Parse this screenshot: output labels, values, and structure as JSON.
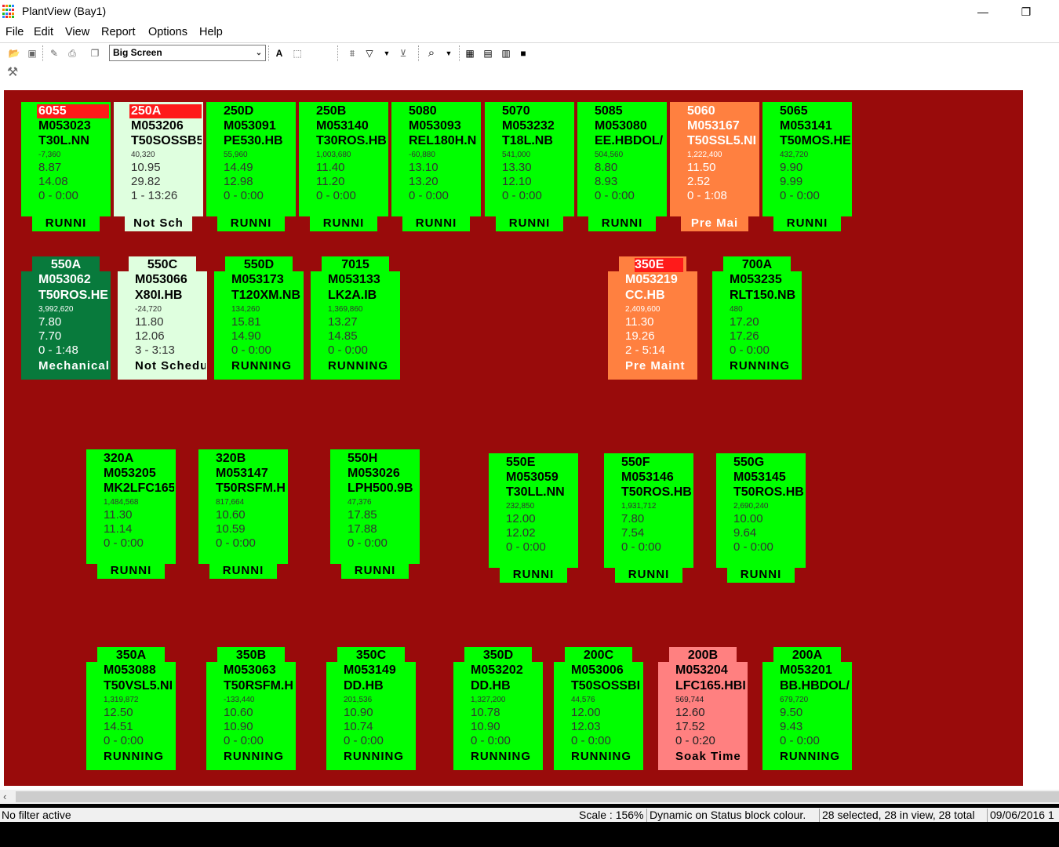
{
  "window": {
    "title": "PlantView (Bay1)",
    "minimize": "—",
    "restore": "❐"
  },
  "menu": [
    "File",
    "Edit",
    "View",
    "Report",
    "Options",
    "Help"
  ],
  "toolbar": {
    "view_select": "Big Screen"
  },
  "colors": {
    "running": "#00ff00",
    "not_scheduled": "#dfffdf",
    "pre_maint": "#ff8040",
    "mechanical": "#087a3c",
    "soak": "#ff8080",
    "canvas": "#990b0b",
    "alarm": "#ff1a1a"
  },
  "machines": [
    {
      "id": "6055",
      "order": "M053023",
      "part": "T30L.NN",
      "count": "-7,360",
      "v1": "8.87",
      "v2": "14.08",
      "time": "0 - 0:00",
      "status": "RUNNI",
      "state": "running",
      "alarm": true
    },
    {
      "id": "250A",
      "order": "M053206",
      "part": "T50SOSSB5",
      "count": "40,320",
      "v1": "10.95",
      "v2": "29.82",
      "time": "1 - 13:26",
      "status": "Not Sch",
      "state": "not_scheduled",
      "alarm": true
    },
    {
      "id": "250D",
      "order": "M053091",
      "part": "PE530.HB",
      "count": "55,960",
      "v1": "14.49",
      "v2": "12.98",
      "time": "0 - 0:00",
      "status": "RUNNI",
      "state": "running"
    },
    {
      "id": "250B",
      "order": "M053140",
      "part": "T30ROS.HB",
      "count": "1,003,680",
      "v1": "11.40",
      "v2": "11.20",
      "time": "0 - 0:00",
      "status": "RUNNI",
      "state": "running"
    },
    {
      "id": "5080",
      "order": "M053093",
      "part": "REL180H.N",
      "count": "-60,880",
      "v1": "13.10",
      "v2": "13.20",
      "time": "0 - 0:00",
      "status": "RUNNI",
      "state": "running"
    },
    {
      "id": "5070",
      "order": "M053232",
      "part": "T18L.NB",
      "count": "541,000",
      "v1": "13.30",
      "v2": "12.10",
      "time": "0 - 0:00",
      "status": "RUNNI",
      "state": "running"
    },
    {
      "id": "5085",
      "order": "M053080",
      "part": "EE.HBDOL/",
      "count": "504,560",
      "v1": "8.80",
      "v2": "8.93",
      "time": "0 - 0:00",
      "status": "RUNNI",
      "state": "running"
    },
    {
      "id": "5060",
      "order": "M053167",
      "part": "T50SSL5.NI",
      "count": "1,222,400",
      "v1": "11.50",
      "v2": "2.52",
      "time": "0 - 1:08",
      "status": "Pre Mai",
      "state": "pre_maint"
    },
    {
      "id": "5065",
      "order": "M053141",
      "part": "T50MOS.HE",
      "count": "432,720",
      "v1": "9.90",
      "v2": "9.99",
      "time": "0 - 0:00",
      "status": "RUNNI",
      "state": "running"
    },
    {
      "id": "550A",
      "order": "M053062",
      "part": "T50ROS.HE",
      "count": "3,992,620",
      "v1": "7.80",
      "v2": "7.70",
      "time": "0 - 1:48",
      "status": "Mechanical",
      "state": "mechanical"
    },
    {
      "id": "550C",
      "order": "M053066",
      "part": "X80I.HB",
      "count": "-24,720",
      "v1": "11.80",
      "v2": "12.06",
      "time": "3 - 3:13",
      "status": "Not Schedu",
      "state": "not_scheduled"
    },
    {
      "id": "550D",
      "order": "M053173",
      "part": "T120XM.NB",
      "count": "134,260",
      "v1": "15.81",
      "v2": "14.90",
      "time": "0 - 0:00",
      "status": "RUNNING",
      "state": "running"
    },
    {
      "id": "7015",
      "order": "M053133",
      "part": "LK2A.IB",
      "count": "1,369,860",
      "v1": "13.27",
      "v2": "14.85",
      "time": "0 - 0:00",
      "status": "RUNNING",
      "state": "running"
    },
    {
      "id": "350E",
      "order": "M053219",
      "part": "CC.HB",
      "count": "2,409,600",
      "v1": "11.30",
      "v2": "19.26",
      "time": "2 - 5:14",
      "status": "Pre Maint",
      "state": "pre_maint",
      "alarm": true
    },
    {
      "id": "700A",
      "order": "M053235",
      "part": "RLT150.NB",
      "count": "480",
      "v1": "17.20",
      "v2": "17.26",
      "time": "0 - 0:00",
      "status": "RUNNING",
      "state": "running"
    },
    {
      "id": "320A",
      "order": "M053205",
      "part": "MK2LFC165",
      "count": "1,484,568",
      "v1": "11.30",
      "v2": "11.14",
      "time": "0 - 0:00",
      "status": "RUNNI",
      "state": "running"
    },
    {
      "id": "320B",
      "order": "M053147",
      "part": "T50RSFM.H",
      "count": "817,664",
      "v1": "10.60",
      "v2": "10.59",
      "time": "0 - 0:00",
      "status": "RUNNI",
      "state": "running"
    },
    {
      "id": "550H",
      "order": "M053026",
      "part": "LPH500.9B",
      "count": "47,376",
      "v1": "17.85",
      "v2": "17.88",
      "time": "0 - 0:00",
      "status": "RUNNI",
      "state": "running"
    },
    {
      "id": "550E",
      "order": "M053059",
      "part": "T30LL.NN",
      "count": "232,850",
      "v1": "12.00",
      "v2": "12.02",
      "time": "0 - 0:00",
      "status": "RUNNI",
      "state": "running"
    },
    {
      "id": "550F",
      "order": "M053146",
      "part": "T50ROS.HB",
      "count": "1,931,712",
      "v1": "7.80",
      "v2": "7.54",
      "time": "0 - 0:00",
      "status": "RUNNI",
      "state": "running"
    },
    {
      "id": "550G",
      "order": "M053145",
      "part": "T50ROS.HB",
      "count": "2,690,240",
      "v1": "10.00",
      "v2": "9.64",
      "time": "0 - 0:00",
      "status": "RUNNI",
      "state": "running"
    },
    {
      "id": "350A",
      "order": "M053088",
      "part": "T50VSL5.NI",
      "count": "1,319,872",
      "v1": "12.50",
      "v2": "14.51",
      "time": "0 - 0:00",
      "status": "RUNNING",
      "state": "running"
    },
    {
      "id": "350B",
      "order": "M053063",
      "part": "T50RSFM.H",
      "count": "-133,440",
      "v1": "10.60",
      "v2": "10.90",
      "time": "0 - 0:00",
      "status": "RUNNING",
      "state": "running"
    },
    {
      "id": "350C",
      "order": "M053149",
      "part": "DD.HB",
      "count": "201,536",
      "v1": "10.90",
      "v2": "10.74",
      "time": "0 - 0:00",
      "status": "RUNNING",
      "state": "running"
    },
    {
      "id": "350D",
      "order": "M053202",
      "part": "DD.HB",
      "count": "1,327,200",
      "v1": "10.78",
      "v2": "10.90",
      "time": "0 - 0:00",
      "status": "RUNNING",
      "state": "running"
    },
    {
      "id": "200C",
      "order": "M053006",
      "part": "T50SOSSBI",
      "count": "44,576",
      "v1": "12.00",
      "v2": "12.03",
      "time": "0 - 0:00",
      "status": "RUNNING",
      "state": "running"
    },
    {
      "id": "200B",
      "order": "M053204",
      "part": "LFC165.HBI",
      "count": "569,744",
      "v1": "12.60",
      "v2": "17.52",
      "time": "0 - 0:20",
      "status": "Soak Time",
      "state": "soak"
    },
    {
      "id": "200A",
      "order": "M053201",
      "part": "BB.HBDOL/",
      "count": "679,720",
      "v1": "9.50",
      "v2": "9.43",
      "time": "0 - 0:00",
      "status": "RUNNING",
      "state": "running"
    }
  ],
  "status": {
    "filter": "No filter active",
    "scale": "Scale : 156%",
    "mode": "Dynamic on Status block colour.",
    "selection": "28 selected, 28 in view, 28 total",
    "date": "09/06/2016 1"
  }
}
